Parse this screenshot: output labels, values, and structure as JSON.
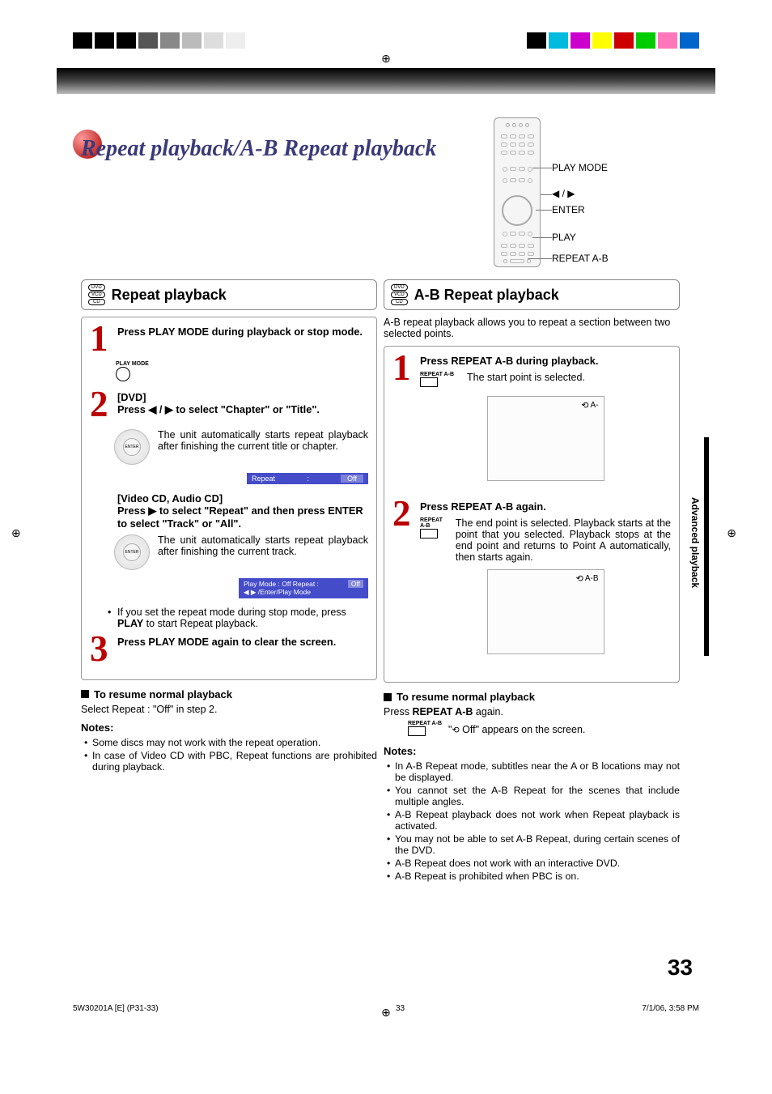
{
  "meta": {
    "page_title": "Repeat playback/A-B Repeat playback",
    "side_tab": "Advanced playback",
    "page_number": "33",
    "footer_left": "5W30201A [E] (P31-33)",
    "footer_mid": "33",
    "footer_right": "7/1/06, 3:58 PM"
  },
  "remote_labels": {
    "play_mode": "PLAY MODE",
    "arrows": "◀ / ▶",
    "enter": "ENTER",
    "play": "PLAY",
    "repeat_ab": "REPEAT A-B"
  },
  "media": {
    "dvd": "DVD",
    "vcd": "VCD",
    "cd": "CD"
  },
  "left": {
    "title": "Repeat playback",
    "step1_title": "Press PLAY MODE during playback or stop mode.",
    "step1_icon_label": "PLAY MODE",
    "step2_dvd_label": "[DVD]",
    "step2_dvd_instr": "Press ◀ / ▶ to select \"Chapter\" or \"Title\".",
    "step2_dvd_desc": "The unit automatically starts repeat playback after finishing the current title or chapter.",
    "osd1_left": "Repeat",
    "osd1_sep": ":",
    "osd1_right": "Off",
    "step2_cd_label": "[Video CD, Audio CD]",
    "step2_cd_instr": "Press ▶ to select \"Repeat\" and then press ENTER to select \"Track\" or \"All\".",
    "step2_cd_desc": "The unit automatically starts repeat playback after finishing the current track.",
    "osd2_line1": "Play Mode :   Off     Repeat  :",
    "osd2_val": "Off",
    "osd2_line2": "◀ ▶ /Enter/Play Mode",
    "stop_note": "If you set the repeat mode during stop mode, press PLAY to start Repeat playback.",
    "stop_bold": "PLAY",
    "step3_title": "Press PLAY MODE again to clear the screen.",
    "resume_head": "To resume normal playback",
    "resume_body": "Select Repeat : \"Off\" in step 2.",
    "notes_title": "Notes:",
    "notes": [
      "Some discs may not work with the repeat operation.",
      "In case of Video CD with PBC, Repeat functions are prohibited during playback."
    ]
  },
  "right": {
    "title": "A-B Repeat playback",
    "intro": "A-B repeat playback allows you to repeat a section between two selected points.",
    "step1_title": "Press REPEAT A-B during playback.",
    "step1_icon_label": "REPEAT A-B",
    "step1_desc": "The start point is selected.",
    "screen1_corner": "A-",
    "step2_title": "Press REPEAT A-B again.",
    "step2_icon_label": "REPEAT A-B",
    "step2_desc": "The end point is selected. Playback starts at the point that you selected. Playback stops at the end point and returns to Point A automatically, then starts again.",
    "screen2_corner": "A-B",
    "resume_head": "To resume normal playback",
    "resume_body_prefix": "Press ",
    "resume_body_bold": "REPEAT A-B",
    "resume_body_suffix": " again.",
    "off_icon_label": "REPEAT A-B",
    "off_msg_pre": "\"",
    "off_msg_mid": "Off",
    "off_msg_post": "\" appears on the screen.",
    "notes_title": "Notes:",
    "notes": [
      "In A-B Repeat mode, subtitles near the A or B locations may not be displayed.",
      "You cannot set the A-B Repeat for the scenes that include multiple angles.",
      "A-B Repeat playback does not work when Repeat playback is activated.",
      "You may not be able to set A-B Repeat, during certain scenes of the DVD.",
      "A-B Repeat does not work with an interactive DVD.",
      "A-B Repeat is prohibited when PBC is on."
    ]
  }
}
